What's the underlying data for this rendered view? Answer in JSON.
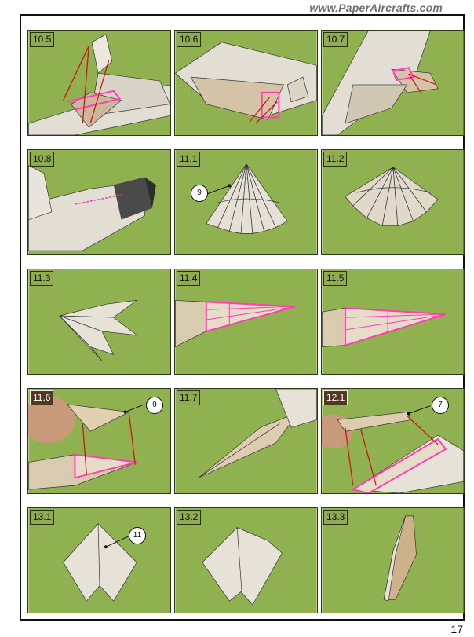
{
  "header": {
    "site_url": "www.PaperAircrafts.com"
  },
  "footer": {
    "page_number": "17"
  },
  "colors": {
    "background": "#8eb150",
    "paper": "#e6e1d6",
    "highlight": "#ff3fb0",
    "arrow": "#d01515"
  },
  "steps": [
    {
      "label": "10.5"
    },
    {
      "label": "10.6"
    },
    {
      "label": "10.7"
    },
    {
      "label": "10.8"
    },
    {
      "label": "11.1",
      "callout": "9"
    },
    {
      "label": "11.2"
    },
    {
      "label": "11.3"
    },
    {
      "label": "11.4"
    },
    {
      "label": "11.5"
    },
    {
      "label": "11.6",
      "callout": "9"
    },
    {
      "label": "11.7"
    },
    {
      "label": "12.1",
      "callout": "7"
    },
    {
      "label": "13.1",
      "callout": "11"
    },
    {
      "label": "13.2"
    },
    {
      "label": "13.3"
    }
  ]
}
